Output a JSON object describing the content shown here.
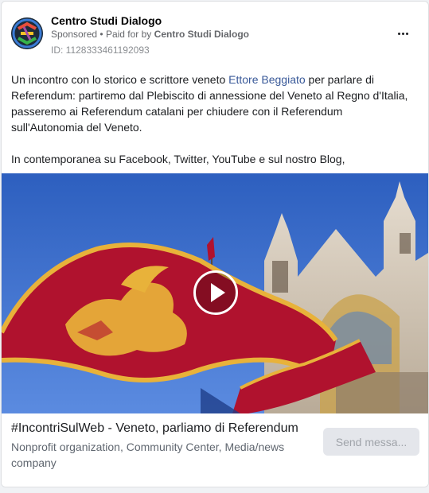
{
  "post": {
    "page_name": "Centro Studi Dialogo",
    "sponsored_label": "Sponsored",
    "separator": "•",
    "paid_for_prefix": "Paid for by",
    "paid_for_name": "Centro Studi Dialogo",
    "ad_id": "ID: 1128333461192093",
    "more_icon": "more-horizontal-icon"
  },
  "body": {
    "part1": "Un incontro con lo storico e scrittore veneto ",
    "link": "Ettore Beggiato",
    "part2": " per parlare di Referendum: partiremo dal Plebiscito di annessione del Veneto al Regno d'Italia, passeremo ai Referendum catalani per chiudere con il Referendum sull'Autonomia del Veneto.",
    "paragraph2": "In contemporanea su Facebook, Twitter, YouTube e sul nostro Blog,"
  },
  "media": {
    "type": "video",
    "play_icon": "play-icon"
  },
  "footer": {
    "headline": "#IncontriSulWeb - Veneto, parliamo di Referendum",
    "categories": "Nonprofit organization, Community Center, Media/news company",
    "cta_label": "Send messa..."
  },
  "colors": {
    "link": "#385898",
    "flag_red": "#b0122e",
    "flag_gold": "#e8b23a",
    "sky": "#3d6fc9"
  }
}
